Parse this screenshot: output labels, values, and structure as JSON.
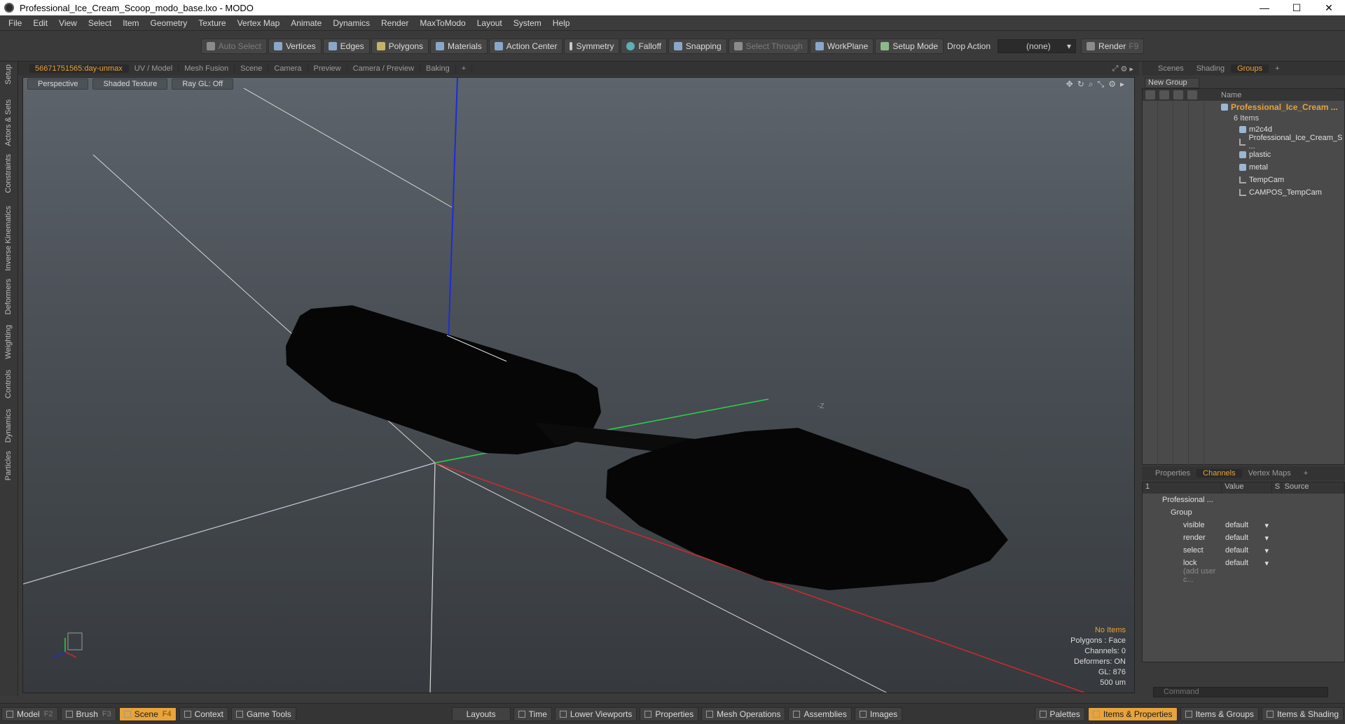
{
  "window": {
    "title": "Professional_Ice_Cream_Scoop_modo_base.lxo - MODO",
    "minimize": "—",
    "maximize": "☐",
    "close": "✕"
  },
  "menu": [
    "File",
    "Edit",
    "View",
    "Select",
    "Item",
    "Geometry",
    "Texture",
    "Vertex Map",
    "Animate",
    "Dynamics",
    "Render",
    "MaxToModo",
    "Layout",
    "System",
    "Help"
  ],
  "toolbar": {
    "auto_select": "Auto Select",
    "vertices": "Vertices",
    "edges": "Edges",
    "polygons": "Polygons",
    "materials": "Materials",
    "action_center": "Action Center",
    "symmetry": "Symmetry",
    "falloff": "Falloff",
    "snapping": "Snapping",
    "select_through": "Select Through",
    "workplane": "WorkPlane",
    "setup_mode": "Setup Mode",
    "drop_action_label": "Drop Action",
    "drop_action_value": "(none)",
    "render": "Render",
    "render_key": "F9"
  },
  "left_tabs": [
    "Setup",
    "Actors & Sets",
    "Constraints",
    "Inverse Kinematics",
    "Deformers",
    "Weighting",
    "Controls",
    "Dynamics",
    "Particles"
  ],
  "viewport_tabs": [
    "56671751565:day-unmax",
    "UV / Model",
    "Mesh Fusion",
    "Scene",
    "Camera",
    "Preview",
    "Camera / Preview",
    "Baking",
    "+"
  ],
  "viewport": {
    "perspective": "Perspective",
    "shading": "Shaded Texture",
    "raygl": "Ray GL: Off",
    "axis_label": "-Z",
    "info": {
      "items": "No Items",
      "polygons": "Polygons : Face",
      "channels": "Channels: 0",
      "deformers": "Deformers: ON",
      "gl": "GL: 876",
      "scale": "500 um"
    }
  },
  "right_tabs": [
    "Scenes",
    "Shading",
    "Groups",
    "+"
  ],
  "new_group": "New Group",
  "tree": {
    "header_name": "Name",
    "group_name": "Professional_Ice_Cream ...",
    "group_count": "6 Items",
    "items": [
      {
        "label": "m2c4d",
        "icon": "group-icon"
      },
      {
        "label": "Professional_Ice_Cream_S ...",
        "icon": "locator-icon"
      },
      {
        "label": "plastic",
        "icon": "material-icon"
      },
      {
        "label": "metal",
        "icon": "material-icon"
      },
      {
        "label": "TempCam",
        "icon": "locator-icon"
      },
      {
        "label": "CAMPOS_TempCam",
        "icon": "locator-icon"
      }
    ]
  },
  "channel_tabs": [
    "Properties",
    "Channels",
    "Vertex Maps",
    "+"
  ],
  "channels": {
    "head": {
      "col1": "1",
      "value": "Value",
      "s": "S",
      "source": "Source"
    },
    "item": "Professional ...",
    "group": "Group",
    "rows": [
      {
        "name": "visible",
        "value": "default"
      },
      {
        "name": "render",
        "value": "default"
      },
      {
        "name": "select",
        "value": "default"
      },
      {
        "name": "lock",
        "value": "default"
      }
    ],
    "add": "(add user c..."
  },
  "command_placeholder": "Command",
  "bottom": {
    "left": [
      {
        "label": "Model",
        "key": "F2"
      },
      {
        "label": "Brush",
        "key": "F3"
      },
      {
        "label": "Scene",
        "key": "F4"
      },
      {
        "label": "Context",
        "key": ""
      },
      {
        "label": "Game Tools",
        "key": ""
      }
    ],
    "mid": [
      "Layouts",
      "Time",
      "Lower Viewports",
      "Properties",
      "Mesh Operations",
      "Assemblies",
      "Images"
    ],
    "right": [
      "Palettes",
      "Items & Properties",
      "Items & Groups",
      "Items & Shading"
    ]
  },
  "colors": {
    "accent": "#e8a33a",
    "axis_x": "#d02a2a",
    "axis_y": "#2ed14a",
    "axis_z": "#1f2bd8"
  }
}
